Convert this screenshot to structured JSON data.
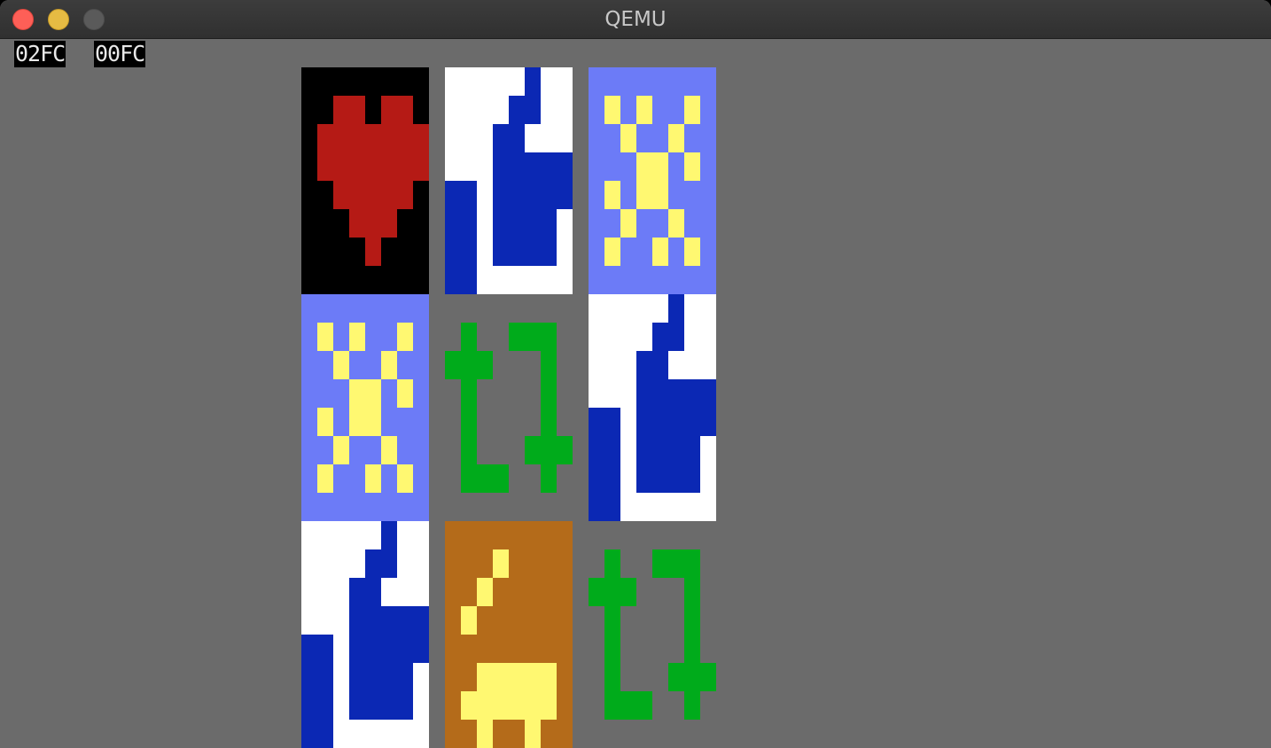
{
  "window": {
    "title": "QEMU",
    "controls": [
      "close",
      "minimize",
      "zoom"
    ]
  },
  "status": {
    "left_hex": "02FC",
    "right_hex": "00FC"
  },
  "grid": {
    "rows": 3,
    "cols": 3,
    "tiles": [
      [
        "heart",
        "boot",
        "sun"
      ],
      [
        "sun",
        "bracket",
        "boot"
      ],
      [
        "boot",
        "cake",
        "bracket"
      ]
    ]
  },
  "colors": {
    "screen_bg": "#6b6b6b",
    "heart_bg": "#000000",
    "heart_fg": "#b51a15",
    "boot_bg": "#ffffff",
    "boot_fg": "#0b28b4",
    "sun_bg": "#6c7bf7",
    "sun_fg": "#fff871",
    "bracket_fg": "#00ab1b",
    "cake_bg": "#b46b1a",
    "cake_fg": "#fff871"
  }
}
